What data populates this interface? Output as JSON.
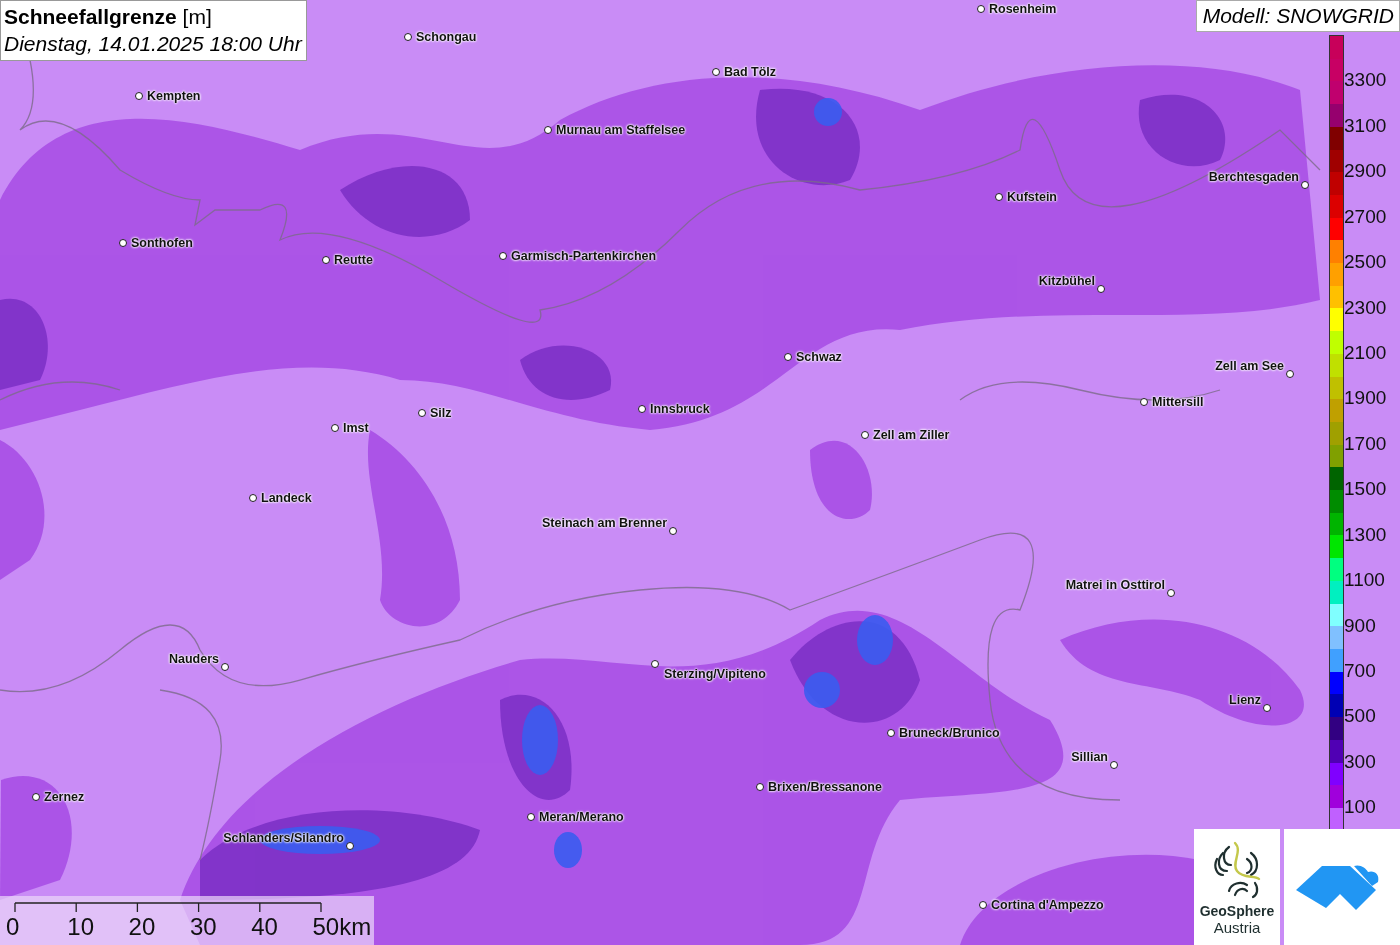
{
  "title": {
    "heading": "**Schneefallgrenze** [m]",
    "datetime": "Dienstag, 14.01.2025 18:00 Uhr"
  },
  "model": "Modell: SNOWGRID",
  "legend": {
    "bands": [
      {
        "color": "#c8005a"
      },
      {
        "color": "#c80064"
      },
      {
        "color": "#c0006e"
      },
      {
        "color": "#96006e"
      },
      {
        "color": "#800000"
      },
      {
        "color": "#a00000"
      },
      {
        "color": "#c00000"
      },
      {
        "color": "#dc0000"
      },
      {
        "color": "#ff0000"
      },
      {
        "color": "#ff8000"
      },
      {
        "color": "#ffa000"
      },
      {
        "color": "#ffc000"
      },
      {
        "color": "#ffff00"
      },
      {
        "color": "#c0ff00"
      },
      {
        "color": "#c0e000"
      },
      {
        "color": "#c0c000"
      },
      {
        "color": "#c0a000"
      },
      {
        "color": "#a0a000"
      },
      {
        "color": "#80a000"
      },
      {
        "color": "#006400"
      },
      {
        "color": "#008c00"
      },
      {
        "color": "#00b400"
      },
      {
        "color": "#00e600"
      },
      {
        "color": "#00ff80"
      },
      {
        "color": "#00f0c0"
      },
      {
        "color": "#80ffff"
      },
      {
        "color": "#80c0ff"
      },
      {
        "color": "#40a0ff"
      },
      {
        "color": "#0000ff"
      },
      {
        "color": "#0000b4"
      },
      {
        "color": "#320082"
      },
      {
        "color": "#5000b4"
      },
      {
        "color": "#8000ff"
      },
      {
        "color": "#a000dc"
      },
      {
        "color": "#c060ff"
      }
    ],
    "labels": [
      "3300",
      "3100",
      "2900",
      "2700",
      "2500",
      "2300",
      "2100",
      "1900",
      "1700",
      "1500",
      "1300",
      "1100",
      "900",
      "700",
      "500",
      "300",
      "100"
    ]
  },
  "cities": [
    {
      "name": "Rosenheim"
    },
    {
      "name": "Schongau"
    },
    {
      "name": "Bad Tölz"
    },
    {
      "name": "Kempten"
    },
    {
      "name": "Murnau am Staffelsee"
    },
    {
      "name": "Berchtesgaden"
    },
    {
      "name": "Kufstein"
    },
    {
      "name": "Sonthofen"
    },
    {
      "name": "Reutte"
    },
    {
      "name": "Garmisch-Partenkirchen"
    },
    {
      "name": "Kitzbühel"
    },
    {
      "name": "Schwaz"
    },
    {
      "name": "Zell am See"
    },
    {
      "name": "Mittersill"
    },
    {
      "name": "Silz"
    },
    {
      "name": "Innsbruck"
    },
    {
      "name": "Imst"
    },
    {
      "name": "Zell am Ziller"
    },
    {
      "name": "Landeck"
    },
    {
      "name": "Steinach am Brenner"
    },
    {
      "name": "Matrei in Osttirol"
    },
    {
      "name": "Nauders"
    },
    {
      "name": "Sterzing/Vipiteno"
    },
    {
      "name": "Lienz"
    },
    {
      "name": "Bruneck/Brunico"
    },
    {
      "name": "Sillian"
    },
    {
      "name": "Brixen/Bressanone"
    },
    {
      "name": "Zernez"
    },
    {
      "name": "Meran/Merano"
    },
    {
      "name": "Schlanders/Silandro"
    },
    {
      "name": "Cortina d'Ampezzo"
    }
  ],
  "scale_bar": {
    "labels": [
      "0",
      "10",
      "20",
      "30",
      "40",
      "50km"
    ]
  },
  "logo": {
    "line_1": "GeoSphere",
    "line_2": "Austria"
  }
}
